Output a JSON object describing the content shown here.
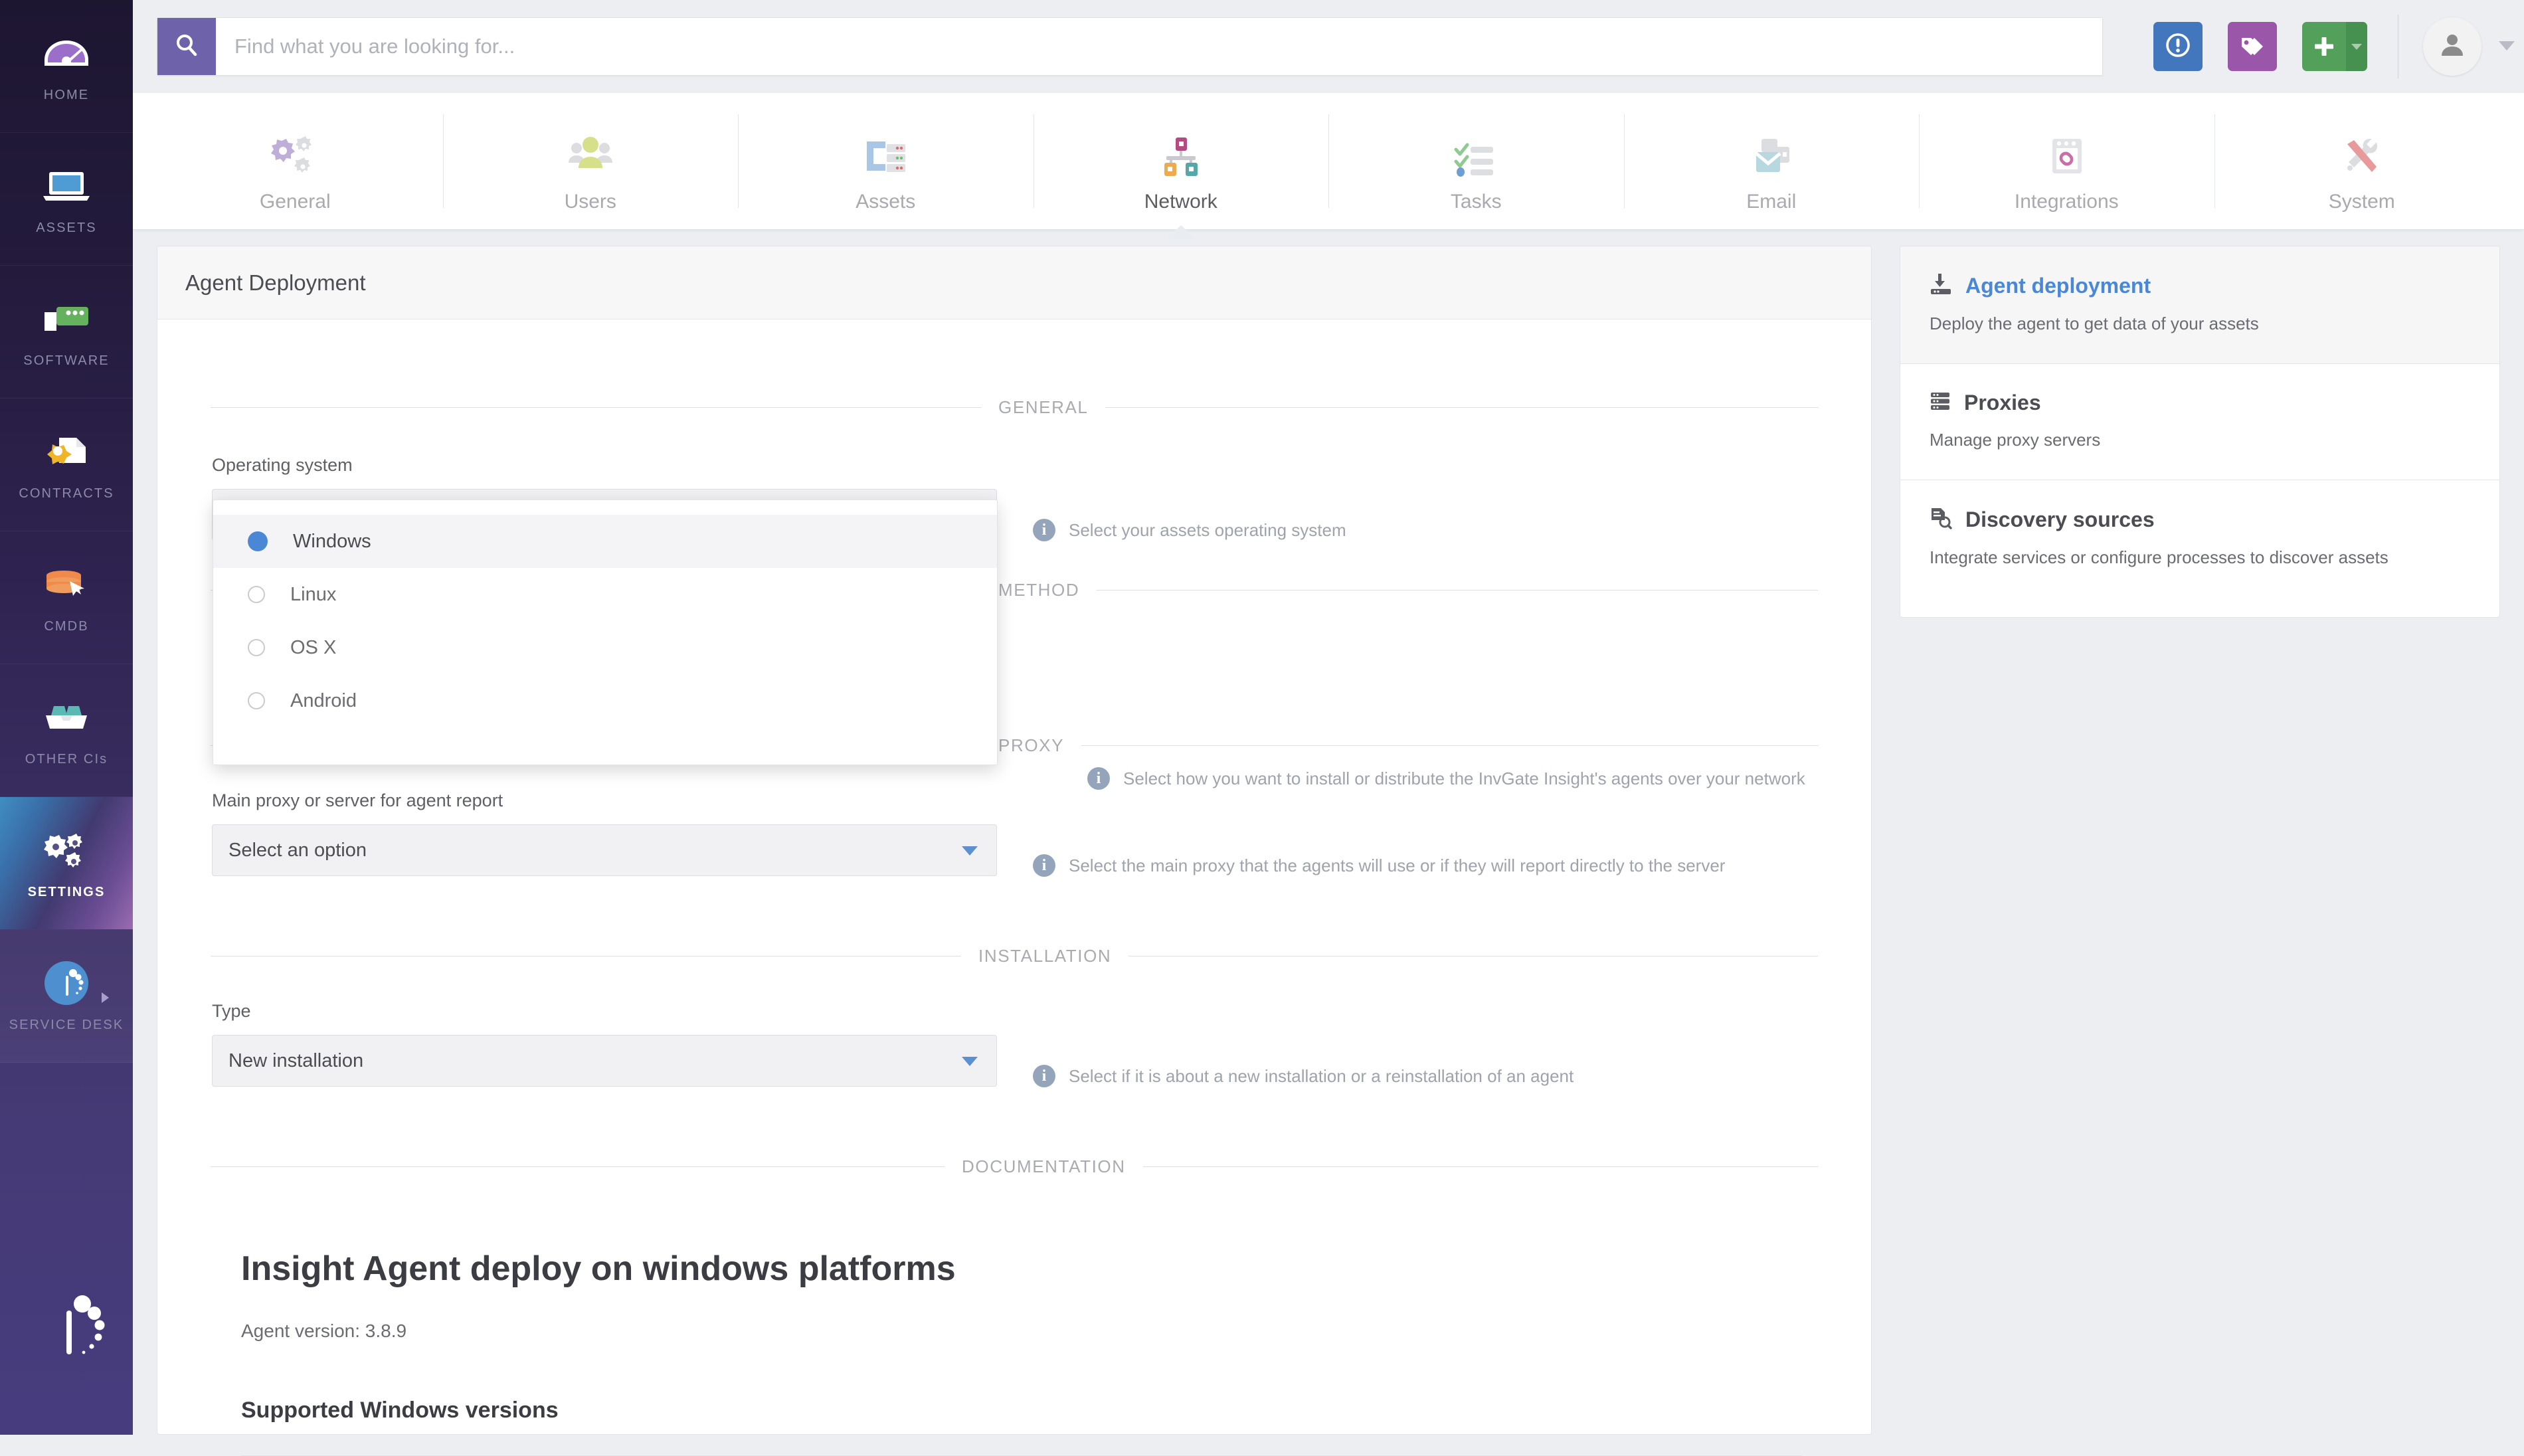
{
  "app": {
    "brand": "InvGate Insight"
  },
  "search": {
    "placeholder": "Find what you are looking for...",
    "value": "",
    "icon": "search-icon"
  },
  "header": {
    "actions": [
      {
        "name": "alert-button",
        "icon": "exclamation-circle-icon",
        "color": "#4277bd"
      },
      {
        "name": "tags-button",
        "icon": "tags-icon",
        "color": "#9a56a8"
      },
      {
        "name": "add-button",
        "icon": "plus-icon",
        "color": "#53a05a"
      }
    ],
    "avatar_icon": "user-avatar-icon"
  },
  "rail": {
    "items": [
      {
        "label": "HOME",
        "icon": "speedometer-icon",
        "active": false
      },
      {
        "label": "ASSETS",
        "icon": "laptop-icon",
        "active": false
      },
      {
        "label": "SOFTWARE",
        "icon": "software-box-icon",
        "active": false
      },
      {
        "label": "CONTRACTS",
        "icon": "contract-seal-icon",
        "active": false
      },
      {
        "label": "CMDB",
        "icon": "database-click-icon",
        "active": false
      },
      {
        "label": "OTHER CIs",
        "icon": "open-box-icon",
        "active": false
      },
      {
        "label": "SETTINGS",
        "icon": "gears-icon",
        "active": true
      },
      {
        "label": "SERVICE DESK",
        "icon": "insight-circle-icon",
        "active": false
      }
    ]
  },
  "tabs": [
    {
      "label": "General",
      "icon": "gears-icon",
      "active": false
    },
    {
      "label": "Users",
      "icon": "users-group-icon",
      "active": false
    },
    {
      "label": "Assets",
      "icon": "assets-rack-icon",
      "active": false
    },
    {
      "label": "Network",
      "icon": "network-nodes-icon",
      "active": true
    },
    {
      "label": "Tasks",
      "icon": "checklist-icon",
      "active": false
    },
    {
      "label": "Email",
      "icon": "envelope-icon",
      "active": false
    },
    {
      "label": "Integrations",
      "icon": "integrations-link-icon",
      "active": false
    },
    {
      "label": "System",
      "icon": "tools-icon",
      "active": false
    }
  ],
  "card": {
    "title": "Agent Deployment",
    "sections": {
      "general": "GENERAL",
      "method": "METHOD",
      "proxy": "PROXY",
      "installation": "INSTALLATION",
      "documentation": "DOCUMENTATION"
    },
    "fields": {
      "os": {
        "label": "Operating system",
        "value": "Windows",
        "hint": "Select your assets operating system",
        "options": [
          {
            "label": "Windows",
            "selected": true
          },
          {
            "label": "Linux",
            "selected": false
          },
          {
            "label": "OS X",
            "selected": false
          },
          {
            "label": "Android",
            "selected": false
          }
        ]
      },
      "method": {
        "hint": "Select how you want to install or distribute the InvGate Insight's agents over your network"
      },
      "proxy": {
        "label": "Main proxy or server for agent report",
        "value": "Select an option",
        "hint": "Select the main proxy that the agents will use or if they will report directly to the server"
      },
      "type": {
        "label": "Type",
        "value": "New installation",
        "hint": "Select if it is about a new installation or a reinstallation of an agent"
      }
    },
    "documentation": {
      "title": "Insight Agent deploy on windows platforms",
      "version": "Agent version: 3.8.9",
      "subtitle": "Supported Windows versions"
    }
  },
  "right_panel": {
    "items": [
      {
        "title": "Agent deployment",
        "desc": "Deploy the agent to get data of your assets",
        "icon": "download-server-icon",
        "active": true
      },
      {
        "title": "Proxies",
        "desc": "Manage proxy servers",
        "icon": "server-stack-icon",
        "active": false
      },
      {
        "title": "Discovery sources",
        "desc": "Integrate services or configure processes to discover assets",
        "icon": "document-search-icon",
        "active": false
      }
    ]
  },
  "colors": {
    "accent_purple": "#6e63ab",
    "accent_blue": "#4a87d4",
    "rail_bg": "#2e2350",
    "page_bg": "#eceef2"
  }
}
